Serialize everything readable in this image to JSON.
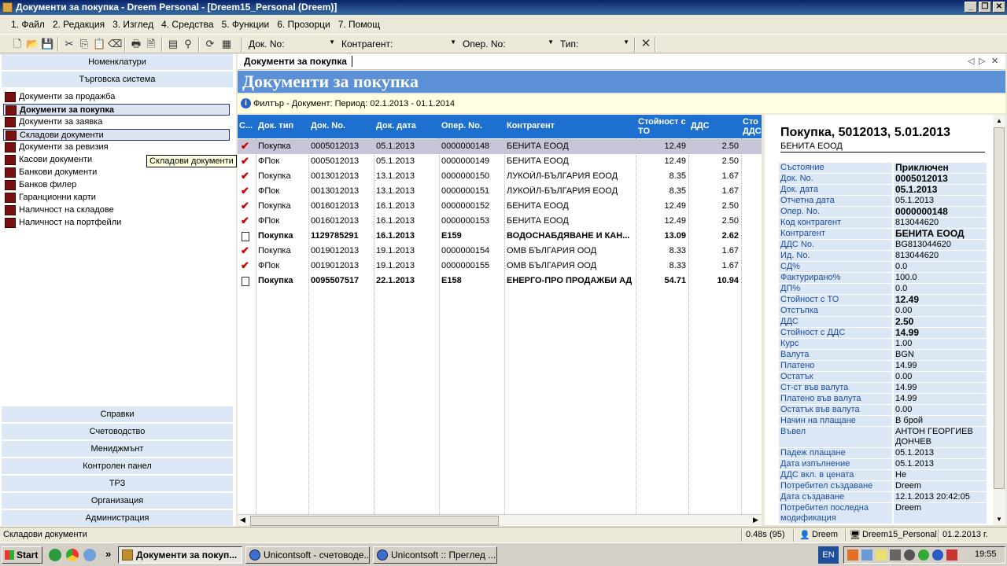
{
  "window": {
    "title": "Документи за покупка - Dreem Personal - [Dreem15_Personal (Dreem)]"
  },
  "menu": [
    "1. Файл",
    "2. Редакция",
    "3. Изглед",
    "4. Средства",
    "5. Функции",
    "6. Прозорци",
    "7. Помощ"
  ],
  "toolbar": {
    "doc_no_label": "Док. No:",
    "contragent_label": "Контрагент:",
    "oper_no_label": "Опер. No:",
    "type_label": "Тип:"
  },
  "left_nav": {
    "top_sections": [
      "Номенклатури",
      "Търговска система"
    ],
    "items": [
      {
        "label": "Документи за продажба",
        "state": ""
      },
      {
        "label": "Документи за покупка",
        "state": "selected"
      },
      {
        "label": "Документи за заявка",
        "state": ""
      },
      {
        "label": "Складови документи",
        "state": "hover"
      },
      {
        "label": "Документи за ревизия",
        "state": ""
      },
      {
        "label": "Касови документи",
        "state": ""
      },
      {
        "label": "Банкови документи",
        "state": ""
      },
      {
        "label": "Банков филер",
        "state": ""
      },
      {
        "label": "Гаранционни карти",
        "state": ""
      },
      {
        "label": "Наличност на складове",
        "state": ""
      },
      {
        "label": "Наличност на портфейли",
        "state": ""
      }
    ],
    "tooltip": "Складови документи",
    "bottom_sections": [
      "Справки",
      "Счетоводство",
      "Мениджмънт",
      "Контролен панел",
      "ТРЗ",
      "Организация",
      "Администрация"
    ]
  },
  "tab": {
    "label": "Документи за покупка"
  },
  "page": {
    "title": "Документи за покупка",
    "filter": "Филтър - Документ: Период: 02.1.2013 - 01.1.2014"
  },
  "grid": {
    "columns": [
      "С...",
      "Док. тип",
      "Док. No.",
      "Док. дата",
      "Опер. No.",
      "Контрагент",
      "Стойност с ТО",
      "ДДС",
      "Сто ДДС"
    ],
    "rows": [
      {
        "status": "check",
        "type": "Покупка",
        "no": "0005012013",
        "date": "05.1.2013",
        "oper": "0000000148",
        "contragent": "БЕНИТА ЕООД",
        "value": "12.49",
        "vat": "2.50",
        "bold": false,
        "selected": true
      },
      {
        "status": "check",
        "type": "ФПок",
        "no": "0005012013",
        "date": "05.1.2013",
        "oper": "0000000149",
        "contragent": "БЕНИТА ЕООД",
        "value": "12.49",
        "vat": "2.50",
        "bold": false,
        "selected": false
      },
      {
        "status": "check",
        "type": "Покупка",
        "no": "0013012013",
        "date": "13.1.2013",
        "oper": "0000000150",
        "contragent": "ЛУКОЙЛ-БЪЛГАРИЯ ЕООД",
        "value": "8.35",
        "vat": "1.67",
        "bold": false,
        "selected": false
      },
      {
        "status": "check",
        "type": "ФПок",
        "no": "0013012013",
        "date": "13.1.2013",
        "oper": "0000000151",
        "contragent": "ЛУКОЙЛ-БЪЛГАРИЯ ЕООД",
        "value": "8.35",
        "vat": "1.67",
        "bold": false,
        "selected": false
      },
      {
        "status": "check",
        "type": "Покупка",
        "no": "0016012013",
        "date": "16.1.2013",
        "oper": "0000000152",
        "contragent": "БЕНИТА ЕООД",
        "value": "12.49",
        "vat": "2.50",
        "bold": false,
        "selected": false
      },
      {
        "status": "check",
        "type": "ФПок",
        "no": "0016012013",
        "date": "16.1.2013",
        "oper": "0000000153",
        "contragent": "БЕНИТА ЕООД",
        "value": "12.49",
        "vat": "2.50",
        "bold": false,
        "selected": false
      },
      {
        "status": "draft",
        "type": "Покупка",
        "no": "1129785291",
        "date": "16.1.2013",
        "oper": "E159",
        "contragent": "ВОДОСНАБДЯВАНЕ И КАН...",
        "value": "13.09",
        "vat": "2.62",
        "bold": true,
        "selected": false
      },
      {
        "status": "check",
        "type": "Покупка",
        "no": "0019012013",
        "date": "19.1.2013",
        "oper": "0000000154",
        "contragent": "ОМВ БЪЛГАРИЯ ООД",
        "value": "8.33",
        "vat": "1.67",
        "bold": false,
        "selected": false
      },
      {
        "status": "check",
        "type": "ФПок",
        "no": "0019012013",
        "date": "19.1.2013",
        "oper": "0000000155",
        "contragent": "ОМВ БЪЛГАРИЯ ООД",
        "value": "8.33",
        "vat": "1.67",
        "bold": false,
        "selected": false
      },
      {
        "status": "draft",
        "type": "Покупка",
        "no": "0095507517",
        "date": "22.1.2013",
        "oper": "E158",
        "contragent": "ЕНЕРГО-ПРО ПРОДАЖБИ АД",
        "value": "54.71",
        "vat": "10.94",
        "bold": true,
        "selected": false
      }
    ]
  },
  "details": {
    "title": "Покупка, 5012013, 5.01.2013",
    "subtitle": "БЕНИТА ЕООД",
    "fields": [
      {
        "k": "Състояние",
        "v": "Приключен",
        "b": true
      },
      {
        "k": "Док. No.",
        "v": "0005012013",
        "b": true
      },
      {
        "k": "Док. дата",
        "v": "05.1.2013",
        "b": true
      },
      {
        "k": "Отчетна дата",
        "v": "05.1.2013",
        "b": false
      },
      {
        "k": "Опер. No.",
        "v": "0000000148",
        "b": true
      },
      {
        "k": "Код контрагент",
        "v": "813044620",
        "b": false
      },
      {
        "k": "Контрагент",
        "v": "БЕНИТА ЕООД",
        "b": true
      },
      {
        "k": "ДДС No.",
        "v": "BG813044620",
        "b": false
      },
      {
        "k": "Ид. No.",
        "v": "813044620",
        "b": false
      },
      {
        "k": "СД%",
        "v": "0.0",
        "b": false
      },
      {
        "k": "Фактурирано%",
        "v": "100.0",
        "b": false
      },
      {
        "k": "ДП%",
        "v": "0.0",
        "b": false
      },
      {
        "k": "Стойност с ТО",
        "v": "12.49",
        "b": true
      },
      {
        "k": "Отстъпка",
        "v": "0.00",
        "b": false
      },
      {
        "k": "ДДС",
        "v": "2.50",
        "b": true
      },
      {
        "k": "Стойност с ДДС",
        "v": "14.99",
        "b": true
      },
      {
        "k": "Курс",
        "v": "1.00",
        "b": false
      },
      {
        "k": "Валута",
        "v": "BGN",
        "b": false
      },
      {
        "k": "Платено",
        "v": "14.99",
        "b": false
      },
      {
        "k": "Остатък",
        "v": "0.00",
        "b": false
      },
      {
        "k": "Ст-ст във валута",
        "v": "14.99",
        "b": false
      },
      {
        "k": "Платено във валута",
        "v": "14.99",
        "b": false
      },
      {
        "k": "Остатък във валута",
        "v": "0.00",
        "b": false
      },
      {
        "k": "Начин на плащане",
        "v": "В брой",
        "b": false
      },
      {
        "k": "Въвел",
        "v": "АНТОН ГЕОРГИЕВ ДОНЧЕВ",
        "b": false,
        "tall": true
      },
      {
        "k": "Падеж плащане",
        "v": "05.1.2013",
        "b": false
      },
      {
        "k": "Дата изпълнение",
        "v": "05.1.2013",
        "b": false
      },
      {
        "k": "ДДС вкл. в цената",
        "v": "Не",
        "b": false
      },
      {
        "k": "Потребител създаване",
        "v": "Dreem",
        "b": false
      },
      {
        "k": "Дата създаване",
        "v": "12.1.2013 20:42:05",
        "b": false
      },
      {
        "k": "Потребител последна модификация",
        "v": "Dreem",
        "b": false,
        "tall": true
      }
    ]
  },
  "statusbar": {
    "text": "Складови документи",
    "timing": "0.48s (95)",
    "user": "Dreem",
    "db": "Dreem15_Personal",
    "date": "01.2.2013 г."
  },
  "taskbar": {
    "start": "Start",
    "tasks": [
      "Документи за покуп...",
      "Unicontsoft - счетоводе...",
      "Unicontsoft :: Преглед ..."
    ],
    "lang": "EN",
    "clock": "19:55"
  }
}
